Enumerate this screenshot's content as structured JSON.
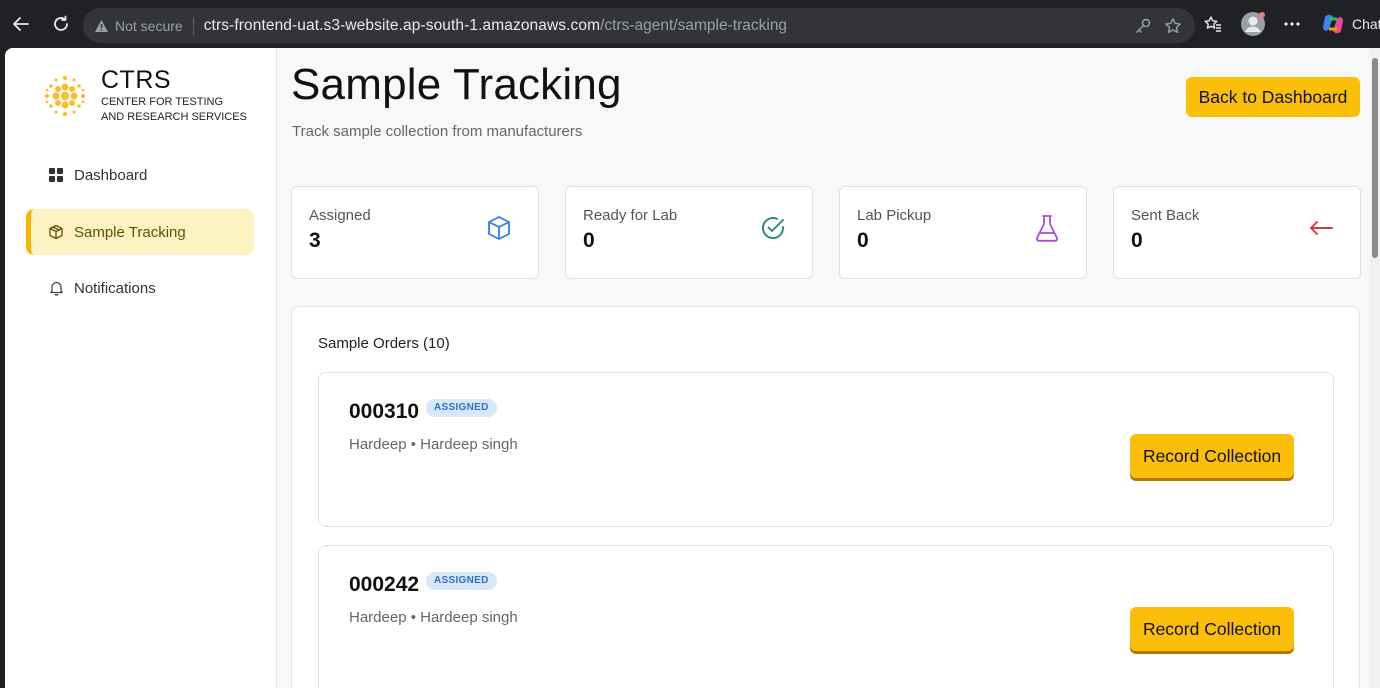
{
  "browser": {
    "security_label": "Not secure",
    "url_host": "ctrs-frontend-uat.s3-website.ap-south-1.amazonaws.com",
    "url_path": "/ctrs-agent/sample-tracking",
    "chat_label": "Chat"
  },
  "sidebar": {
    "brand_name": "CTRS",
    "brand_sub_line1": "CENTER FOR TESTING",
    "brand_sub_line2": "AND RESEARCH SERVICES",
    "items": [
      {
        "label": "Dashboard",
        "icon": "grid-icon"
      },
      {
        "label": "Sample Tracking",
        "icon": "box-icon",
        "active": true
      },
      {
        "label": "Notifications",
        "icon": "bell-icon"
      }
    ]
  },
  "header": {
    "title": "Sample Tracking",
    "subtitle": "Track sample collection from manufacturers",
    "back_label": "Back to Dashboard"
  },
  "stats": [
    {
      "label": "Assigned",
      "value": "3",
      "icon": "cube-icon",
      "color": "#2f80ed"
    },
    {
      "label": "Ready for Lab",
      "value": "0",
      "icon": "check-circle-icon",
      "color": "#1e8a6e"
    },
    {
      "label": "Lab Pickup",
      "value": "0",
      "icon": "flask-icon",
      "color": "#a64ee0"
    },
    {
      "label": "Sent Back",
      "value": "0",
      "icon": "arrow-left-icon",
      "color": "#d33a3a"
    }
  ],
  "orders": {
    "title": "Sample Orders (10)",
    "items": [
      {
        "id": "000310",
        "status": "ASSIGNED",
        "meta": "Hardeep • Hardeep singh",
        "action": "Record Collection"
      },
      {
        "id": "000242",
        "status": "ASSIGNED",
        "meta": "Hardeep • Hardeep singh",
        "action": "Record Collection"
      }
    ]
  },
  "colors": {
    "accent": "#fbbf09",
    "active_bg": "#fdf3c2",
    "badge_bg": "#d8e8fb",
    "badge_text": "#2f6fc7"
  }
}
